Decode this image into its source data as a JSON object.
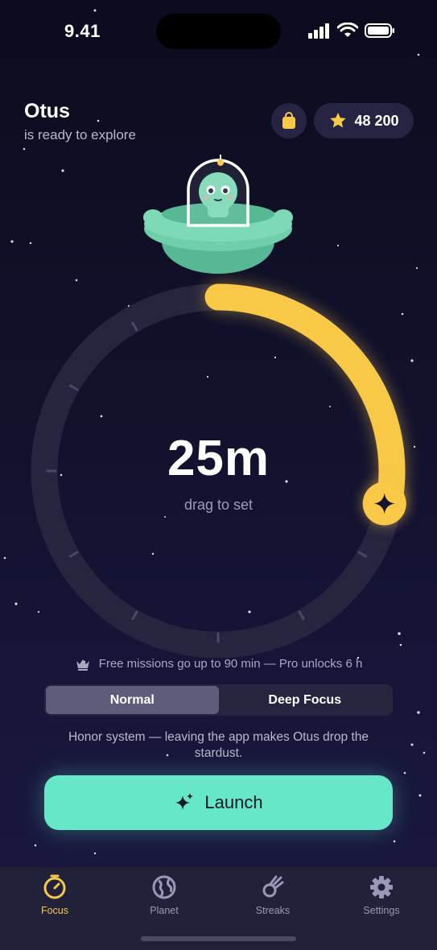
{
  "status": {
    "time": "9.41"
  },
  "header": {
    "name": "Otus",
    "subtitle": "is ready to explore",
    "coins": "48 200"
  },
  "timer": {
    "value": "25m",
    "hint": "drag to set",
    "minutes": 25,
    "max_minutes": 90
  },
  "info": {
    "pro_note": "Free missions go up to 90 min — Pro unlocks 6 h"
  },
  "modes": {
    "options": [
      "Normal",
      "Deep Focus"
    ],
    "selected": "Normal"
  },
  "honor_text": "Honor system — leaving the app makes Otus drop the stardust.",
  "launch_label": "Launch",
  "tabs": [
    {
      "label": "Focus",
      "icon": "timer-icon",
      "active": true
    },
    {
      "label": "Planet",
      "icon": "globe-icon",
      "active": false
    },
    {
      "label": "Streaks",
      "icon": "meteor-icon",
      "active": false
    },
    {
      "label": "Settings",
      "icon": "gear-icon",
      "active": false
    }
  ],
  "colors": {
    "accent": "#f8c846",
    "launch": "#66e7c8",
    "alien": "#7ed9b7"
  }
}
